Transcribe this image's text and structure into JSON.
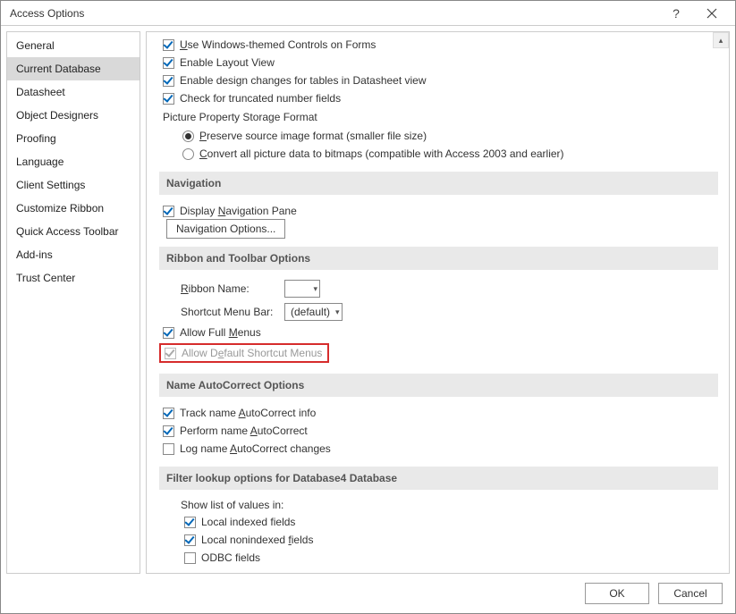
{
  "window": {
    "title": "Access Options",
    "help_label": "?",
    "close_label": "×"
  },
  "sidebar": {
    "items": [
      "General",
      "Current Database",
      "Datasheet",
      "Object Designers",
      "Proofing",
      "Language",
      "Client Settings",
      "Customize Ribbon",
      "Quick Access Toolbar",
      "Add-ins",
      "Trust Center"
    ],
    "selected_index": 1
  },
  "checkboxes": {
    "use_windows_themed": {
      "label_pre": "",
      "u": "U",
      "label_post": "se Windows-themed Controls on Forms",
      "checked": true
    },
    "enable_layout_view": {
      "label": "Enable Layout View",
      "checked": true
    },
    "enable_design_changes": {
      "label": "Enable design changes for tables in Datasheet view",
      "checked": true
    },
    "check_truncated": {
      "label": "Check for truncated number fields",
      "checked": true
    }
  },
  "picture_format": {
    "label": "Picture Property Storage Format",
    "preserve": {
      "u": "P",
      "rest": "reserve source image format (smaller file size)",
      "selected": true
    },
    "convert": {
      "u": "C",
      "rest": "onvert all picture data to bitmaps (compatible with Access 2003 and earlier)",
      "selected": false
    }
  },
  "navigation": {
    "header": "Navigation",
    "display_pane": {
      "pre": "Display ",
      "u": "N",
      "post": "avigation Pane",
      "checked": true
    },
    "options_button": "Navigation Options..."
  },
  "ribbon_toolbar": {
    "header": "Ribbon and Toolbar Options",
    "ribbon_name": {
      "u": "R",
      "rest": "ibbon Name:"
    },
    "ribbon_name_value": "",
    "shortcut_menu_bar_label": "Shortcut Menu Bar:",
    "shortcut_menu_bar_value": "(default)",
    "allow_full_menus": {
      "pre": "Allow Full ",
      "u": "M",
      "post": "enus",
      "checked": true
    },
    "allow_default_shortcut": {
      "pre": "Allow D",
      "u": "e",
      "post": "fault Shortcut Menus",
      "checked": true
    }
  },
  "name_autocorrect": {
    "header": "Name AutoCorrect Options",
    "track": {
      "pre": "Track name ",
      "u": "A",
      "post": "utoCorrect info",
      "checked": true
    },
    "perform": {
      "pre": "Perform name ",
      "u": "A",
      "post": "utoCorrect",
      "checked": true
    },
    "log": {
      "pre": "Log name ",
      "u": "A",
      "post": "utoCorrect changes",
      "checked": false
    }
  },
  "filter_lookup": {
    "header": "Filter lookup options for Database4 Database",
    "show_list_label": "Show list of values in:",
    "local_indexed": {
      "label": "Local indexed fields",
      "checked": true
    },
    "local_nonindexed": {
      "pre": "Local nonindexed ",
      "u": "f",
      "post": "ields",
      "checked": true
    },
    "odbc": {
      "label": "ODBC fields",
      "checked": false
    }
  },
  "footer": {
    "ok": "OK",
    "cancel": "Cancel"
  }
}
